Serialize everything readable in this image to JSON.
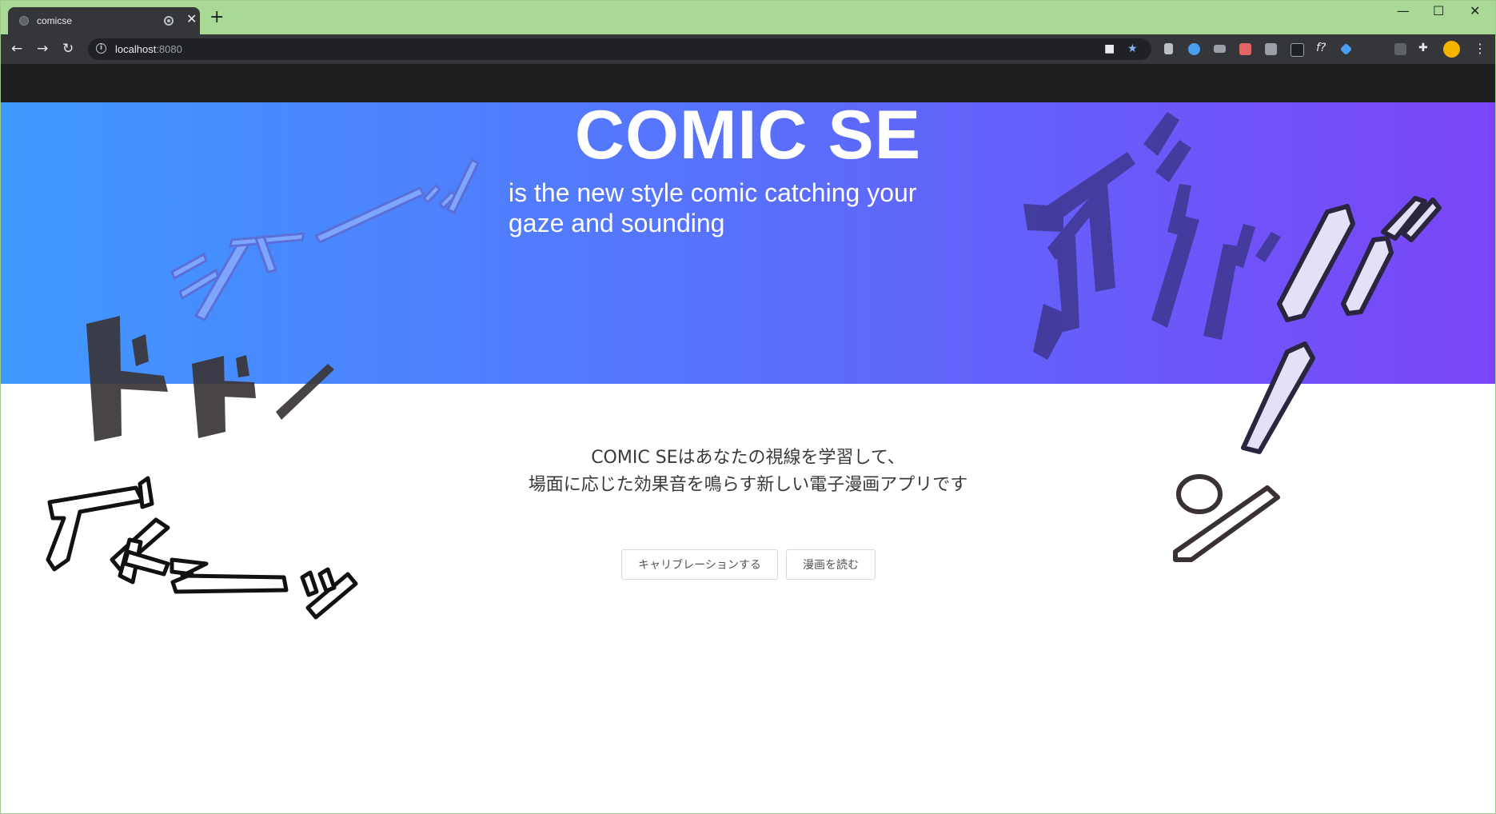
{
  "browser": {
    "tab_title": "comicse",
    "tab_close": "✕",
    "new_tab": "+",
    "url_host": "localhost",
    "url_port": ":8080",
    "window_minimize": "—",
    "window_maximize": "☐",
    "window_close": "✕"
  },
  "hero": {
    "title": "COMIC SE",
    "subtitle": "is the new style comic catching your gaze and sounding"
  },
  "description": {
    "line1": "COMIC SEはあなたの視線を学習して、",
    "line2": "場面に応じた効果音を鳴らす新しい電子漫画アプリです"
  },
  "buttons": {
    "calibrate": "キャリブレーションする",
    "read": "漫画を読む"
  },
  "colors": {
    "hero_gradient_start": "#3f99ff",
    "hero_gradient_end": "#7b45f7",
    "nav_bar": "#1f1f1f",
    "tab_strip": "#a9d996"
  }
}
